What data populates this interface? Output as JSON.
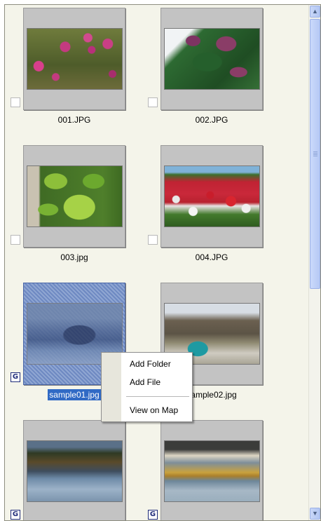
{
  "files": [
    {
      "name": "001.JPG",
      "badge": "",
      "selected": false
    },
    {
      "name": "002.JPG",
      "badge": "",
      "selected": false
    },
    {
      "name": "003.jpg",
      "badge": "",
      "selected": false
    },
    {
      "name": "004.JPG",
      "badge": "",
      "selected": false
    },
    {
      "name": "sample01.jpg",
      "badge": "G",
      "selected": true
    },
    {
      "name": "sample02.jpg",
      "badge": "G",
      "selected": false
    },
    {
      "name": "",
      "badge": "G",
      "selected": false
    },
    {
      "name": "",
      "badge": "G",
      "selected": false
    }
  ],
  "context_menu": {
    "items": [
      "Add Folder",
      "Add File",
      "View on Map"
    ]
  },
  "scrollbar": {
    "up_arrow": "▲",
    "down_arrow": "▼"
  }
}
